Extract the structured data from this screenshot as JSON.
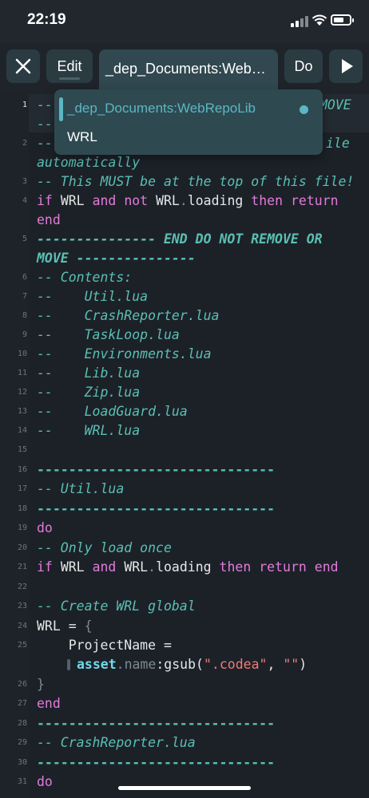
{
  "status": {
    "time": "22:19"
  },
  "toolbar": {
    "edit_label": "Edit",
    "tab_label": "_dep_Documents:WebRepoLib",
    "do_label": "Do"
  },
  "dropdown": {
    "items": [
      "_dep_Documents:WebRepoLib",
      "WRL"
    ]
  },
  "editor": {
    "line_numbers": [
      "1",
      "2",
      "3",
      "4",
      "5",
      "6",
      "7",
      "8",
      "9",
      "10",
      "11",
      "12",
      "13",
      "14",
      "15",
      "16",
      "17",
      "18",
      "19",
      "20",
      "21",
      "22",
      "23",
      "24",
      "25",
      "26",
      "27",
      "28",
      "29",
      "30",
      "31"
    ],
    "text": {
      "l1a": "--",
      "l1b": "MOVE",
      "l1c": "--",
      "l2a": "--",
      "l2b": "ile",
      "l2c": "automatically",
      "l3": "-- This MUST be at the top of this file!",
      "l4_if": "if",
      "l4_wrl": "WRL",
      "l4_and": "and",
      "l4_not": "not",
      "l4_wrl2": "WRL",
      "l4_dot": ".",
      "l4_loading": "loading",
      "l4_then": "then",
      "l4_return": "return",
      "l4_end": "end",
      "l5a": "--------------- END DO NOT REMOVE OR",
      "l5b": "MOVE ---------------",
      "l6": "-- Contents:",
      "l7": "--    Util.lua",
      "l8": "--    CrashReporter.lua",
      "l9": "--    TaskLoop.lua",
      "l10": "--    Environments.lua",
      "l11": "--    Lib.lua",
      "l12": "--    Zip.lua",
      "l13": "--    LoadGuard.lua",
      "l14": "--    WRL.lua",
      "l16": "------------------------------",
      "l17": "-- Util.lua",
      "l18": "------------------------------",
      "l19": "do",
      "l20": "-- Only load once",
      "l21_if": "if",
      "l21_wrl": "WRL",
      "l21_and": "and",
      "l21_wrl2": "WRL",
      "l21_dot": ".",
      "l21_loading": "loading",
      "l21_then": "then",
      "l21_return": "return",
      "l21_end": "end",
      "l23": "-- Create WRL global",
      "l24_wrl": "WRL",
      "l24_eq": " = ",
      "l24_brace": "{",
      "l25a_name": "    ProjectName",
      "l25a_eq": " =",
      "l25b_asset": "asset",
      "l25b_dot": ".",
      "l25b_name": "name",
      "l25b_colon": ":",
      "l25b_gsub": "gsub(",
      "l25b_s1": "\".codea\"",
      "l25b_comma": ", ",
      "l25b_s2": "\"\"",
      "l25b_close": ")",
      "l26": "}",
      "l27": "end",
      "l28": "------------------------------",
      "l29": "-- CrashReporter.lua",
      "l30": "------------------------------",
      "l31": "do"
    }
  }
}
